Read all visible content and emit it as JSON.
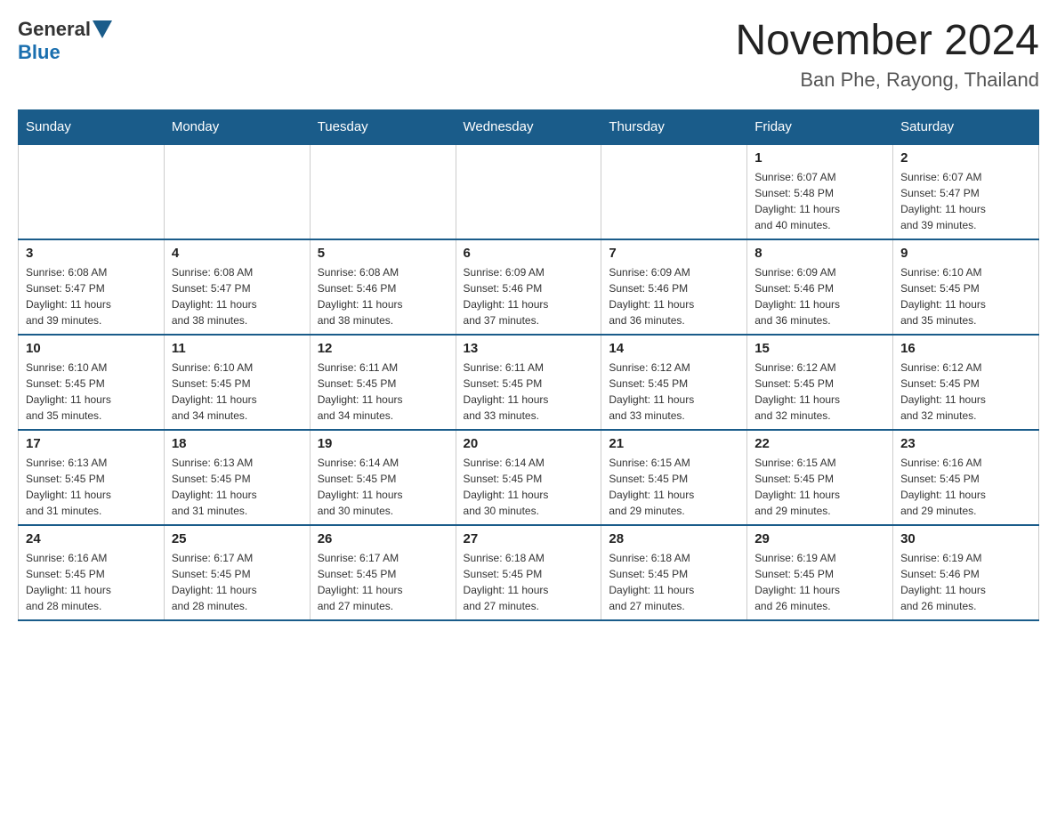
{
  "header": {
    "logo_general": "General",
    "logo_blue": "Blue",
    "month_title": "November 2024",
    "location": "Ban Phe, Rayong, Thailand"
  },
  "days_of_week": [
    "Sunday",
    "Monday",
    "Tuesday",
    "Wednesday",
    "Thursday",
    "Friday",
    "Saturday"
  ],
  "weeks": [
    [
      {
        "day": "",
        "info": ""
      },
      {
        "day": "",
        "info": ""
      },
      {
        "day": "",
        "info": ""
      },
      {
        "day": "",
        "info": ""
      },
      {
        "day": "",
        "info": ""
      },
      {
        "day": "1",
        "info": "Sunrise: 6:07 AM\nSunset: 5:48 PM\nDaylight: 11 hours\nand 40 minutes."
      },
      {
        "day": "2",
        "info": "Sunrise: 6:07 AM\nSunset: 5:47 PM\nDaylight: 11 hours\nand 39 minutes."
      }
    ],
    [
      {
        "day": "3",
        "info": "Sunrise: 6:08 AM\nSunset: 5:47 PM\nDaylight: 11 hours\nand 39 minutes."
      },
      {
        "day": "4",
        "info": "Sunrise: 6:08 AM\nSunset: 5:47 PM\nDaylight: 11 hours\nand 38 minutes."
      },
      {
        "day": "5",
        "info": "Sunrise: 6:08 AM\nSunset: 5:46 PM\nDaylight: 11 hours\nand 38 minutes."
      },
      {
        "day": "6",
        "info": "Sunrise: 6:09 AM\nSunset: 5:46 PM\nDaylight: 11 hours\nand 37 minutes."
      },
      {
        "day": "7",
        "info": "Sunrise: 6:09 AM\nSunset: 5:46 PM\nDaylight: 11 hours\nand 36 minutes."
      },
      {
        "day": "8",
        "info": "Sunrise: 6:09 AM\nSunset: 5:46 PM\nDaylight: 11 hours\nand 36 minutes."
      },
      {
        "day": "9",
        "info": "Sunrise: 6:10 AM\nSunset: 5:45 PM\nDaylight: 11 hours\nand 35 minutes."
      }
    ],
    [
      {
        "day": "10",
        "info": "Sunrise: 6:10 AM\nSunset: 5:45 PM\nDaylight: 11 hours\nand 35 minutes."
      },
      {
        "day": "11",
        "info": "Sunrise: 6:10 AM\nSunset: 5:45 PM\nDaylight: 11 hours\nand 34 minutes."
      },
      {
        "day": "12",
        "info": "Sunrise: 6:11 AM\nSunset: 5:45 PM\nDaylight: 11 hours\nand 34 minutes."
      },
      {
        "day": "13",
        "info": "Sunrise: 6:11 AM\nSunset: 5:45 PM\nDaylight: 11 hours\nand 33 minutes."
      },
      {
        "day": "14",
        "info": "Sunrise: 6:12 AM\nSunset: 5:45 PM\nDaylight: 11 hours\nand 33 minutes."
      },
      {
        "day": "15",
        "info": "Sunrise: 6:12 AM\nSunset: 5:45 PM\nDaylight: 11 hours\nand 32 minutes."
      },
      {
        "day": "16",
        "info": "Sunrise: 6:12 AM\nSunset: 5:45 PM\nDaylight: 11 hours\nand 32 minutes."
      }
    ],
    [
      {
        "day": "17",
        "info": "Sunrise: 6:13 AM\nSunset: 5:45 PM\nDaylight: 11 hours\nand 31 minutes."
      },
      {
        "day": "18",
        "info": "Sunrise: 6:13 AM\nSunset: 5:45 PM\nDaylight: 11 hours\nand 31 minutes."
      },
      {
        "day": "19",
        "info": "Sunrise: 6:14 AM\nSunset: 5:45 PM\nDaylight: 11 hours\nand 30 minutes."
      },
      {
        "day": "20",
        "info": "Sunrise: 6:14 AM\nSunset: 5:45 PM\nDaylight: 11 hours\nand 30 minutes."
      },
      {
        "day": "21",
        "info": "Sunrise: 6:15 AM\nSunset: 5:45 PM\nDaylight: 11 hours\nand 29 minutes."
      },
      {
        "day": "22",
        "info": "Sunrise: 6:15 AM\nSunset: 5:45 PM\nDaylight: 11 hours\nand 29 minutes."
      },
      {
        "day": "23",
        "info": "Sunrise: 6:16 AM\nSunset: 5:45 PM\nDaylight: 11 hours\nand 29 minutes."
      }
    ],
    [
      {
        "day": "24",
        "info": "Sunrise: 6:16 AM\nSunset: 5:45 PM\nDaylight: 11 hours\nand 28 minutes."
      },
      {
        "day": "25",
        "info": "Sunrise: 6:17 AM\nSunset: 5:45 PM\nDaylight: 11 hours\nand 28 minutes."
      },
      {
        "day": "26",
        "info": "Sunrise: 6:17 AM\nSunset: 5:45 PM\nDaylight: 11 hours\nand 27 minutes."
      },
      {
        "day": "27",
        "info": "Sunrise: 6:18 AM\nSunset: 5:45 PM\nDaylight: 11 hours\nand 27 minutes."
      },
      {
        "day": "28",
        "info": "Sunrise: 6:18 AM\nSunset: 5:45 PM\nDaylight: 11 hours\nand 27 minutes."
      },
      {
        "day": "29",
        "info": "Sunrise: 6:19 AM\nSunset: 5:45 PM\nDaylight: 11 hours\nand 26 minutes."
      },
      {
        "day": "30",
        "info": "Sunrise: 6:19 AM\nSunset: 5:46 PM\nDaylight: 11 hours\nand 26 minutes."
      }
    ]
  ]
}
